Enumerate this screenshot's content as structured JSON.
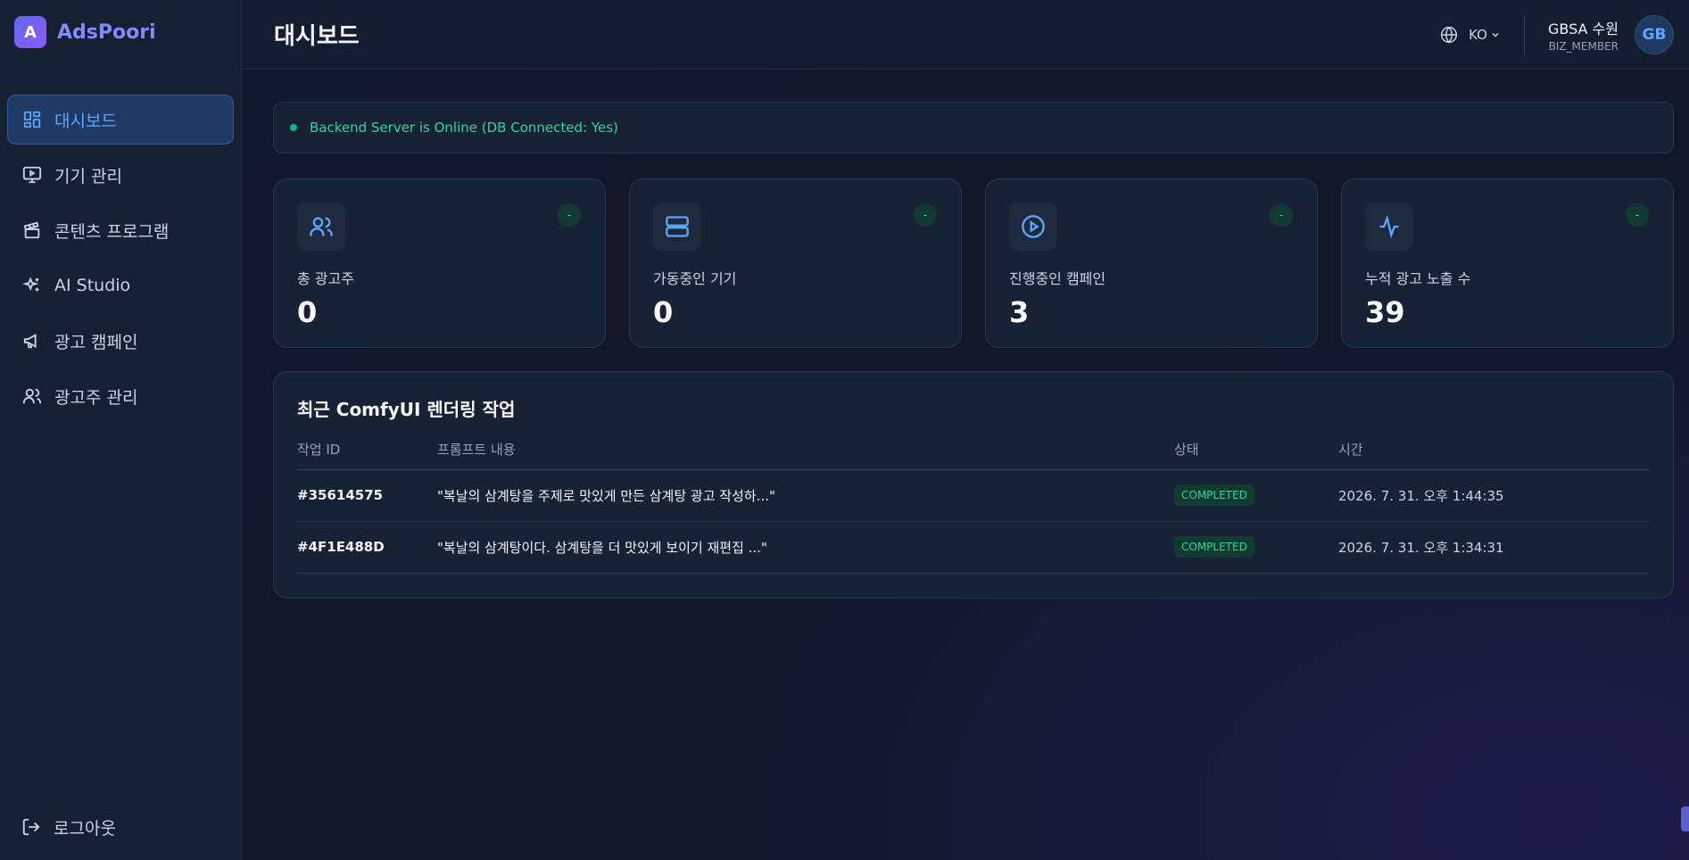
{
  "brand": {
    "logo_letter": "A",
    "name": "AdsPoori"
  },
  "sidebar": {
    "items": [
      {
        "label": "대시보드",
        "icon": "layout-dashboard-icon",
        "active": true
      },
      {
        "label": "기기 관리",
        "icon": "monitor-play-icon",
        "active": false
      },
      {
        "label": "콘텐츠 프로그램",
        "icon": "clapperboard-icon",
        "active": false
      },
      {
        "label": "AI Studio",
        "icon": "sparkles-icon",
        "active": false
      },
      {
        "label": "광고 캠페인",
        "icon": "megaphone-icon",
        "active": false
      },
      {
        "label": "광고주 관리",
        "icon": "users-icon",
        "active": false
      }
    ],
    "logout_label": "로그아웃"
  },
  "header": {
    "title": "대시보드",
    "language": "KO",
    "user_name": "GBSA 수원",
    "user_role": "BIZ_MEMBER",
    "avatar_initials": "GB"
  },
  "status": {
    "message": "Backend Server is Online (DB Connected: Yes)"
  },
  "stats": [
    {
      "label": "총 광고주",
      "value": "0",
      "badge": "-",
      "icon": "users-icon"
    },
    {
      "label": "가동중인 기기",
      "value": "0",
      "badge": "-",
      "icon": "server-icon"
    },
    {
      "label": "진행중인 캠페인",
      "value": "3",
      "badge": "-",
      "icon": "play-circle-icon"
    },
    {
      "label": "누적 광고 노출 수",
      "value": "39",
      "badge": "-",
      "icon": "activity-icon"
    }
  ],
  "jobs": {
    "title": "최근 ComfyUI 렌더링 작업",
    "columns": [
      "작업 ID",
      "프롬프트 내용",
      "상태",
      "시간"
    ],
    "rows": [
      {
        "id": "#35614575",
        "prompt": "\"복날의 삼계탕을 주제로 맛있게 만든 삼계탕 광고 작성하...\"",
        "status": "COMPLETED",
        "time": "2026. 7. 31. 오후 1:44:35"
      },
      {
        "id": "#4F1E488D",
        "prompt": "\"복날의 삼계탕이다. 삼계탕을 더 맛있게 보이기 재편집 ...\"",
        "status": "COMPLETED",
        "time": "2026. 7. 31. 오후 1:34:31"
      }
    ]
  },
  "colors": {
    "accent": "#60a5fa",
    "brand": "#818cf8",
    "success": "#34d399",
    "background": "#0f172a"
  }
}
